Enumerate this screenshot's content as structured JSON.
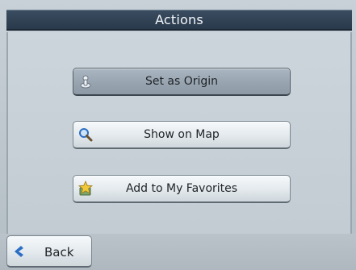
{
  "title": "Actions",
  "actions": [
    {
      "label": "Set as Origin",
      "icon": "origin-person-icon",
      "selected": true
    },
    {
      "label": "Show on Map",
      "icon": "magnifier-icon",
      "selected": false
    },
    {
      "label": "Add to My Favorites",
      "icon": "favorites-star-icon",
      "selected": false
    }
  ],
  "back": {
    "label": "Back",
    "icon": "back-arrow-icon"
  },
  "colors": {
    "titlebar": "#2f4053",
    "background": "#c2ccd2",
    "accent_blue": "#2b6fc4"
  }
}
